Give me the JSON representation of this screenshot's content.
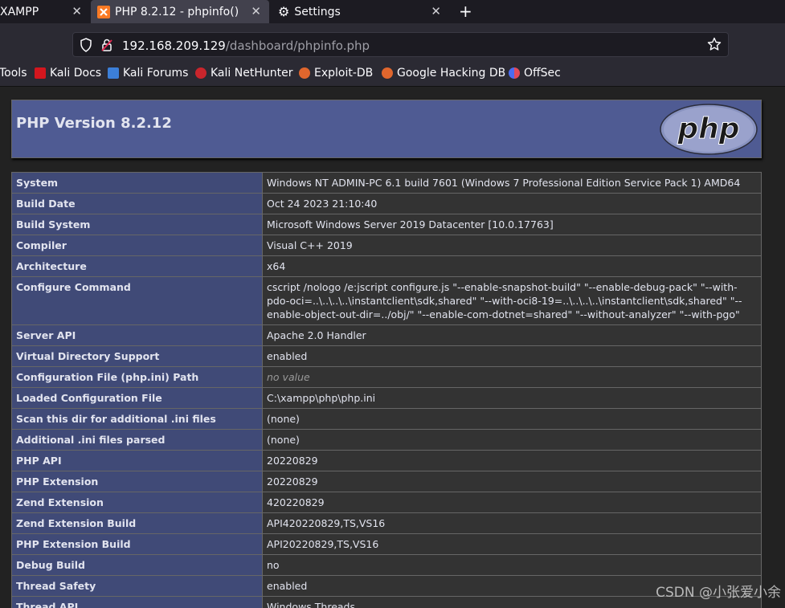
{
  "tabs": [
    {
      "title": "XAMPP",
      "close": "✕"
    },
    {
      "title": "PHP 8.2.12 - phpinfo()",
      "close": "✕"
    },
    {
      "title": "Settings",
      "close": "✕"
    }
  ],
  "new_tab": "+",
  "url": {
    "host": "192.168.209.129",
    "path": "/dashboard/phpinfo.php"
  },
  "bookmarks": [
    {
      "label": "Tools",
      "icon": "tools-icon"
    },
    {
      "label": "Kali Docs",
      "icon": "kali-docs-icon"
    },
    {
      "label": "Kali Forums",
      "icon": "kali-forums-icon"
    },
    {
      "label": "Kali NetHunter",
      "icon": "nethunter-icon"
    },
    {
      "label": "Exploit-DB",
      "icon": "exploit-db-icon"
    },
    {
      "label": "Google Hacking DB",
      "icon": "ghdb-icon"
    },
    {
      "label": "OffSec",
      "icon": "offsec-icon"
    }
  ],
  "php": {
    "version_title": "PHP Version 8.2.12",
    "logo_text": "php",
    "rows": [
      {
        "key": "System",
        "value": "Windows NT ADMIN-PC 6.1 build 7601 (Windows 7 Professional Edition Service Pack 1) AMD64"
      },
      {
        "key": "Build Date",
        "value": "Oct 24 2023 21:10:40"
      },
      {
        "key": "Build System",
        "value": "Microsoft Windows Server 2019 Datacenter [10.0.17763]"
      },
      {
        "key": "Compiler",
        "value": "Visual C++ 2019"
      },
      {
        "key": "Architecture",
        "value": "x64"
      },
      {
        "key": "Configure Command",
        "value": "cscript /nologo /e:jscript configure.js \"--enable-snapshot-build\" \"--enable-debug-pack\" \"--with-pdo-oci=..\\..\\..\\..\\instantclient\\sdk,shared\" \"--with-oci8-19=..\\..\\..\\..\\instantclient\\sdk,shared\" \"--enable-object-out-dir=../obj/\" \"--enable-com-dotnet=shared\" \"--without-analyzer\" \"--with-pgo\""
      },
      {
        "key": "Server API",
        "value": "Apache 2.0 Handler"
      },
      {
        "key": "Virtual Directory Support",
        "value": "enabled"
      },
      {
        "key": "Configuration File (php.ini) Path",
        "value": "no value"
      },
      {
        "key": "Loaded Configuration File",
        "value": "C:\\xampp\\php\\php.ini"
      },
      {
        "key": "Scan this dir for additional .ini files",
        "value": "(none)"
      },
      {
        "key": "Additional .ini files parsed",
        "value": "(none)"
      },
      {
        "key": "PHP API",
        "value": "20220829"
      },
      {
        "key": "PHP Extension",
        "value": "20220829"
      },
      {
        "key": "Zend Extension",
        "value": "420220829"
      },
      {
        "key": "Zend Extension Build",
        "value": "API420220829,TS,VS16"
      },
      {
        "key": "PHP Extension Build",
        "value": "API20220829,TS,VS16"
      },
      {
        "key": "Debug Build",
        "value": "no"
      },
      {
        "key": "Thread Safety",
        "value": "enabled"
      },
      {
        "key": "Thread API",
        "value": "Windows Threads"
      }
    ]
  },
  "watermark": "CSDN @小张爱小余"
}
